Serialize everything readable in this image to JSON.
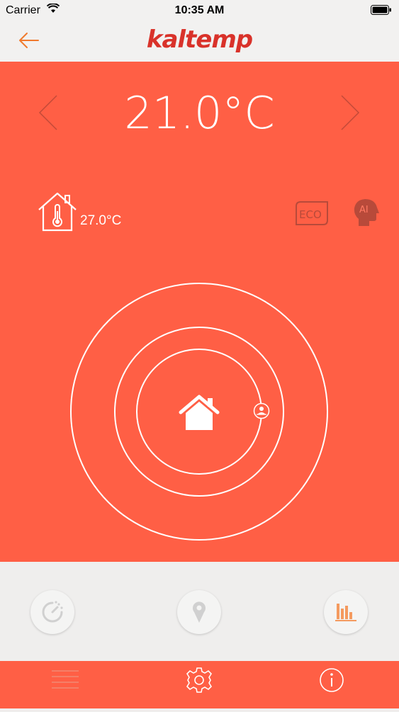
{
  "status_bar": {
    "carrier": "Carrier",
    "time": "10:35 AM",
    "icons": [
      "wifi-icon",
      "battery-icon"
    ]
  },
  "header": {
    "logo_text": "kaltemp",
    "back_icon": "arrow-left-icon"
  },
  "thermostat": {
    "setpoint": "21.0°C",
    "indoor_temperature": "27.0°C",
    "mode_icons": [
      "eco-icon",
      "ai-head-icon"
    ],
    "center_icon": "home-icon",
    "presence_icon": "person-pin-icon"
  },
  "actions": {
    "buttons": [
      "timer-icon",
      "location-pin-icon",
      "bar-chart-icon"
    ]
  },
  "tab_bar": {
    "tabs": [
      "menu-icon",
      "settings-gear-icon",
      "info-icon"
    ]
  },
  "colors": {
    "accent": "#ff5f45",
    "logo": "#d9322a",
    "panel": "#efeeed"
  }
}
